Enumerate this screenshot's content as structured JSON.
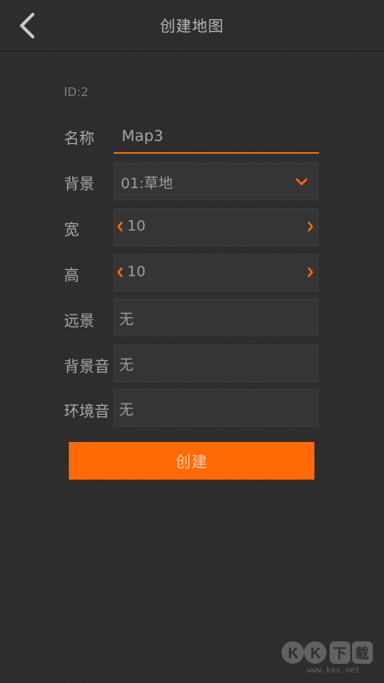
{
  "header": {
    "title": "创建地图",
    "back_icon": "chevron-left-icon"
  },
  "form": {
    "id_text": "ID:2",
    "name": {
      "label": "名称",
      "value": "Map3"
    },
    "background": {
      "label": "背景",
      "value": "01:草地"
    },
    "width": {
      "label": "宽",
      "value": "10"
    },
    "height": {
      "label": "高",
      "value": "10"
    },
    "distant_view": {
      "label": "远景",
      "value": "无"
    },
    "bgm": {
      "label": "背景音",
      "value": "无"
    },
    "ambient_sound": {
      "label": "环境音",
      "value": "无"
    },
    "create_button": "创建"
  },
  "watermark": {
    "logo_text": "KK下载",
    "url": "www.kkx.net"
  },
  "colors": {
    "accent": "#ff6a06",
    "background": "#2d2d2d",
    "field": "#353535",
    "label": "#a8a8a8"
  }
}
